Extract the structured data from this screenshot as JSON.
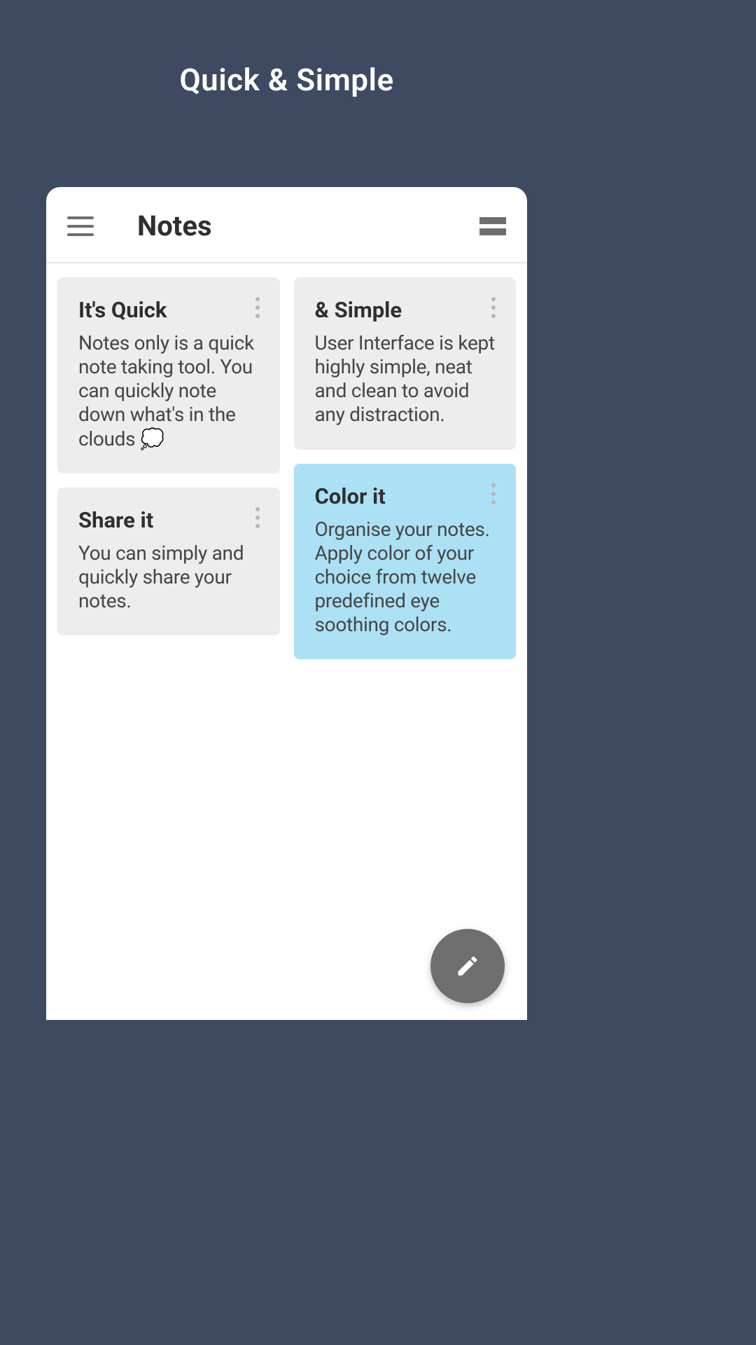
{
  "header": {
    "title": "Quick & Simple"
  },
  "toolbar": {
    "title": "Notes"
  },
  "notes": {
    "left": [
      {
        "title": "It's Quick",
        "body": "Notes only is a quick note taking tool. You can quickly note down what's in the clouds 💭"
      },
      {
        "title": "Share it",
        "body": "You can simply and quickly share your notes."
      }
    ],
    "right": [
      {
        "title": "& Simple",
        "body": "User Interface is kept highly simple, neat and clean to avoid any distraction."
      },
      {
        "title": "Color it",
        "body": "Organise your notes. Apply color of your choice from twelve predefined eye soothing colors."
      }
    ]
  },
  "colors": {
    "accent_card": "#ace1f5"
  }
}
